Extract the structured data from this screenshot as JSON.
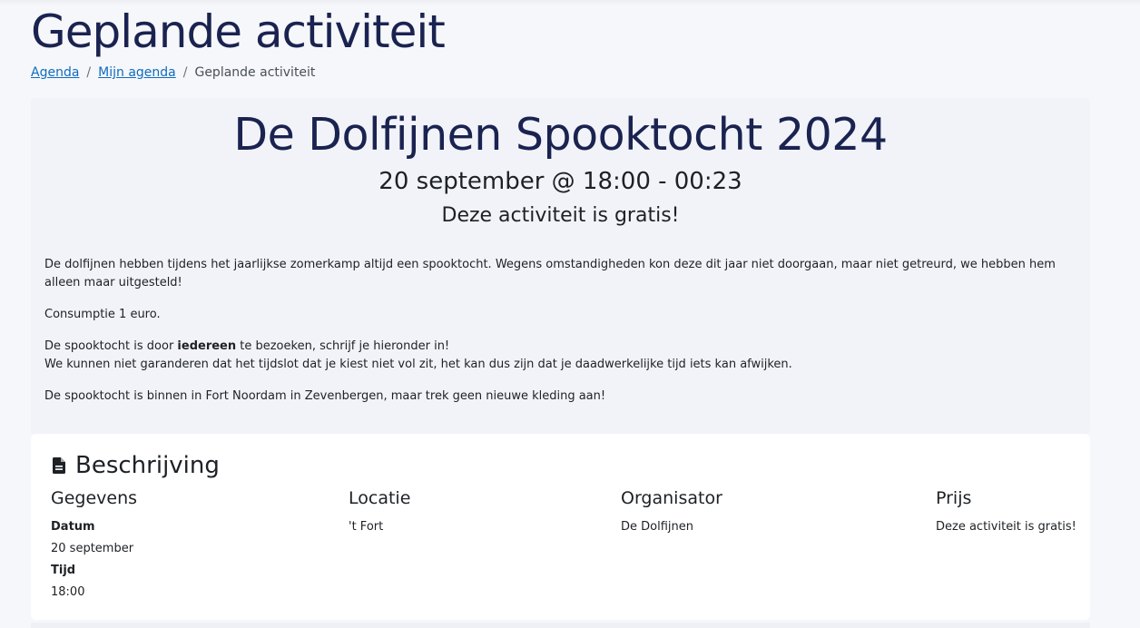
{
  "page": {
    "title": "Geplande activiteit"
  },
  "breadcrumb": {
    "items": [
      {
        "label": "Agenda"
      },
      {
        "label": "Mijn agenda"
      },
      {
        "label": "Geplande activiteit"
      }
    ],
    "separator": "/"
  },
  "event": {
    "title": "De Dolfijnen Spooktocht 2024",
    "datetime": "20 september @ 18:00 - 00:23",
    "price_banner": "Deze activiteit is gratis!",
    "paragraphs": {
      "p1": "De dolfijnen hebben tijdens het jaarlijkse zomerkamp altijd een spooktocht. Wegens omstandigheden kon deze dit jaar niet doorgaan, maar niet getreurd, we hebben hem al­leen maar uitgesteld!",
      "p2": "Consumptie 1 euro.",
      "p3_before": "De spooktocht is door ",
      "p3_bold": "iedereen",
      "p3_after": " te bezoeken, schrijf je hieronder in!",
      "p3_line2": "We kunnen niet garanderen dat het tijdslot dat je kiest niet vol zit, het kan dus zijn dat je daadwerkelijke tijd iets kan afwijken.",
      "p4": "De spooktocht is binnen in Fort Noordam in Zevenbergen, maar trek geen nieuwe kleding aan!"
    }
  },
  "details": {
    "heading": "Beschrijving",
    "heading_icon": "document-icon",
    "gegevens": {
      "title": "Gegevens",
      "datum_label": "Datum",
      "datum_value": "20 september",
      "tijd_label": "Tijd",
      "tijd_value": "18:00"
    },
    "locatie": {
      "title": "Locatie",
      "value": "'t Fort"
    },
    "organisator": {
      "title": "Organisator",
      "value": "De Dolfijnen"
    },
    "prijs": {
      "title": "Prijs",
      "value": "Deze activiteit is gratis!"
    }
  },
  "colors": {
    "title": "#1a2350",
    "link": "#0f6cbf",
    "page_bg": "#f6f7fa",
    "event_card_bg": "#f1f3f8",
    "details_card_bg": "#ffffff"
  }
}
